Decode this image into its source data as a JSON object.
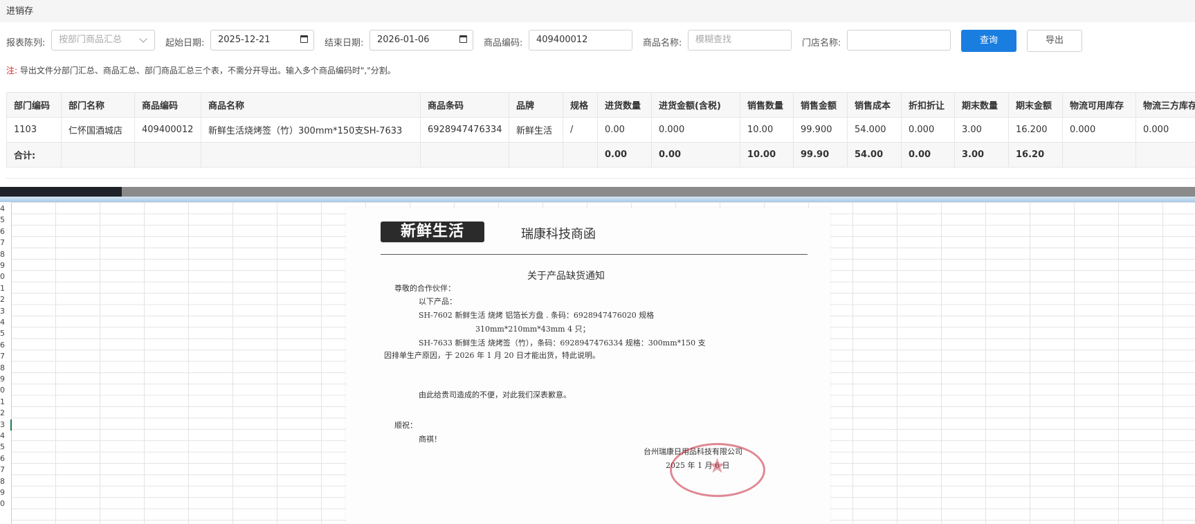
{
  "page_title": "进销存",
  "filters": {
    "report_label": "报表陈列:",
    "report_value": "按部门商品汇总",
    "start_label": "起始日期:",
    "start_value": "2025-12-21",
    "end_label": "结束日期:",
    "end_value": "2026-01-06",
    "code_label": "商品编码:",
    "code_value": "409400012",
    "name_label": "商品名称:",
    "name_placeholder": "模糊查找",
    "store_label": "门店名称:",
    "store_value": "",
    "query_button": "查询",
    "export_button": "导出"
  },
  "note": {
    "prefix": "注:",
    "text": "导出文件分部门汇总、商品汇总、部门商品汇总三个表，不需分开导出。输入多个商品编码时\",\"分割。"
  },
  "table": {
    "headers": [
      "部门编码",
      "部门名称",
      "商品编码",
      "商品名称",
      "商品条码",
      "品牌",
      "规格",
      "进货数量",
      "进货金额(含税)",
      "销售数量",
      "销售金额",
      "销售成本",
      "折扣折让",
      "期末数量",
      "期末金额",
      "物流可用库存",
      "物流三方库存"
    ],
    "rows": [
      [
        "1103",
        "仁怀国酒城店",
        "409400012",
        "新鲜生活烧烤签（竹）300mm*150支SH-7633",
        "6928947476334",
        "新鲜生活",
        "/",
        "0.00",
        "0.000",
        "10.00",
        "99.900",
        "54.000",
        "0.000",
        "3.00",
        "16.200",
        "0.000",
        "0.000"
      ]
    ],
    "total": [
      "合计:",
      "",
      "",
      "",
      "",
      "",
      "",
      "0.00",
      "0.00",
      "10.00",
      "99.90",
      "54.00",
      "0.00",
      "3.00",
      "16.20",
      "",
      ""
    ]
  },
  "sheet": {
    "row_numbers": [
      "4",
      "5",
      "6",
      "7",
      "8",
      "9",
      "0",
      "1",
      "2",
      "3",
      "4",
      "5",
      "6",
      "7",
      "8",
      "9",
      "0",
      "1",
      "2",
      "3",
      "4",
      "5",
      "6",
      "7",
      "8",
      "9",
      "0"
    ],
    "active_row_index": 19
  },
  "letter": {
    "logo_text": "新鲜生活",
    "header": "瑞康科技商函",
    "title": "关于产品缺货通知",
    "greeting": "尊敬的合作伙伴：",
    "line1": "以下产品：",
    "line2": "SH-7602 新鲜生活 烧烤 铝箔长方盘 . 条码：6928947476020 规格",
    "line3": "310mm*210mm*43mm 4 只；",
    "line4": "SH-7633 新鲜生活 烧烤签（竹），条码：6928947476334 规格：300mm*150 支",
    "line5": "因排单生产原因，于 2026 年 1 月 20 日才能出货，特此说明。",
    "line6": "由此给贵司造成的不便，对此我们深表歉意。",
    "closing1": "顺祝：",
    "closing2": "商祺！",
    "company": "台州瑞康日用品科技有限公司",
    "date": "2025 年 1 月 6 日"
  },
  "colors": {
    "primary": "#1a7ee0",
    "note_red": "#e02020",
    "seal_red": "#c8283c"
  }
}
